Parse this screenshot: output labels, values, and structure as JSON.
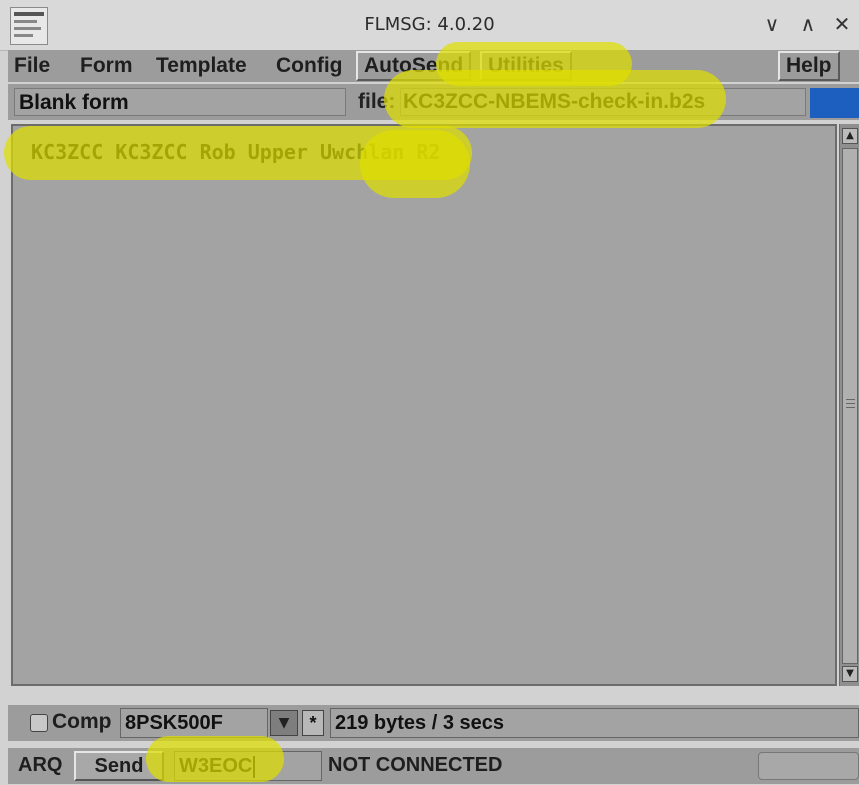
{
  "window": {
    "title": "FLMSG: 4.0.20",
    "controls": [
      "∨",
      "∧",
      "✕"
    ]
  },
  "menu": {
    "file": "File",
    "form": "Form",
    "template": "Template",
    "config": "Config",
    "autosend": "AutoSend",
    "utilities": "Utilities",
    "help": "Help"
  },
  "form_bar": {
    "form_name": "Blank form",
    "file_label": "file:",
    "file_name": "KC3ZCC-NBEMS-check-in.b2s"
  },
  "editor": {
    "text": "KC3ZCC KC3ZCC Rob Upper Uwchlan R2"
  },
  "status": {
    "comp_label": "Comp",
    "comp_checked": false,
    "mode": "8PSK500F",
    "star_label": "*",
    "transfer_info": "219 bytes / 3 secs"
  },
  "arq": {
    "label": "ARQ",
    "send_label": "Send",
    "callsign": "W3EOC",
    "connection_status": "NOT CONNECTED"
  },
  "colors": {
    "highlight": "#dede00",
    "accent_block": "#1d5fbf"
  }
}
